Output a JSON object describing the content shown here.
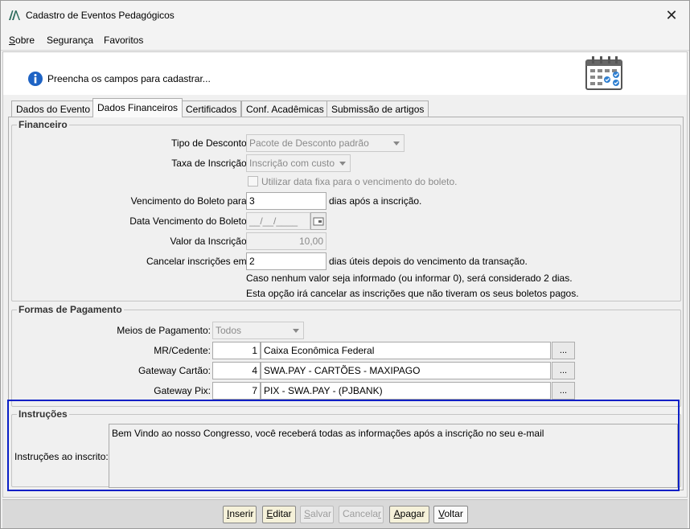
{
  "window": {
    "title": "Cadastro de Eventos Pedagógicos",
    "close_label": "✕"
  },
  "menu": {
    "items": [
      {
        "label": "Sobre",
        "accel": "S",
        "rest": "obre"
      },
      {
        "label": "Segurança"
      },
      {
        "label": "Favoritos"
      }
    ]
  },
  "header": {
    "info_text": "Preencha os campos para cadastrar..."
  },
  "tabs": [
    {
      "label": "Dados do Evento"
    },
    {
      "label": "Dados Financeiros",
      "active": true
    },
    {
      "label": "Certificados"
    },
    {
      "label": "Conf. Acadêmicas"
    },
    {
      "label": "Submissão de artigos"
    }
  ],
  "financeiro": {
    "title": "Financeiro",
    "tipo_desconto_label": "Tipo de Desconto:",
    "tipo_desconto_value": "Pacote de Desconto padrão",
    "taxa_inscricao_label": "Taxa de Inscrição:",
    "taxa_inscricao_value": "Inscrição com custo",
    "data_fixa_label": "Utilizar data fixa para o vencimento do boleto.",
    "data_fixa_checked": false,
    "vencimento_label": "Vencimento do Boleto para:",
    "vencimento_value": "3",
    "vencimento_suffix": "dias após a inscrição.",
    "data_vencimento_label": "Data Vencimento do Boleto:",
    "data_vencimento_value": "__/__/____",
    "valor_label": "Valor da Inscrição:",
    "valor_value": "10,00",
    "cancelar_label": "Cancelar inscrições em:",
    "cancelar_value": "2",
    "cancelar_suffix": "dias úteis depois do vencimento da transação.",
    "note_line1": "Caso nenhum valor seja informado (ou informar 0), será considerado 2 dias.",
    "note_line2": "Esta opção irá cancelar as inscrições que não tiveram os seus boletos pagos."
  },
  "pagamento": {
    "title": "Formas de Pagamento",
    "meios_label": "Meios de Pagamento:",
    "meios_value": "Todos",
    "rows": [
      {
        "label": "MR/Cedente:",
        "code": "1",
        "name": "Caixa Econômica Federal",
        "button": "..."
      },
      {
        "label": "Gateway Cartão:",
        "code": "4",
        "name": "SWA.PAY - CARTÕES - MAXIPAGO",
        "button": "..."
      },
      {
        "label": "Gateway Pix:",
        "code": "7",
        "name": "PIX - SWA.PAY - (PJBANK)",
        "button": "..."
      }
    ]
  },
  "instrucoes": {
    "title": "Instruções",
    "label": "Instruções ao inscrito:",
    "text": "Bem Vindo ao nosso Congresso, você receberá todas as informações após a inscrição no seu e-mail"
  },
  "buttons": {
    "inserir": {
      "accel": "I",
      "rest": "nserir"
    },
    "editar": {
      "accel": "E",
      "rest": "ditar"
    },
    "salvar": {
      "accel": "S",
      "rest": "alvar"
    },
    "cancelar": {
      "pre": "Cancela",
      "accel": "r",
      "rest": ""
    },
    "apagar": {
      "accel": "A",
      "rest": "pagar"
    },
    "voltar": {
      "accel": "V",
      "rest": "oltar"
    }
  },
  "colors": {
    "highlight_border": "#0a1fc6",
    "info_icon": "#1e63c4",
    "button_bg": "#f5f1d9"
  }
}
